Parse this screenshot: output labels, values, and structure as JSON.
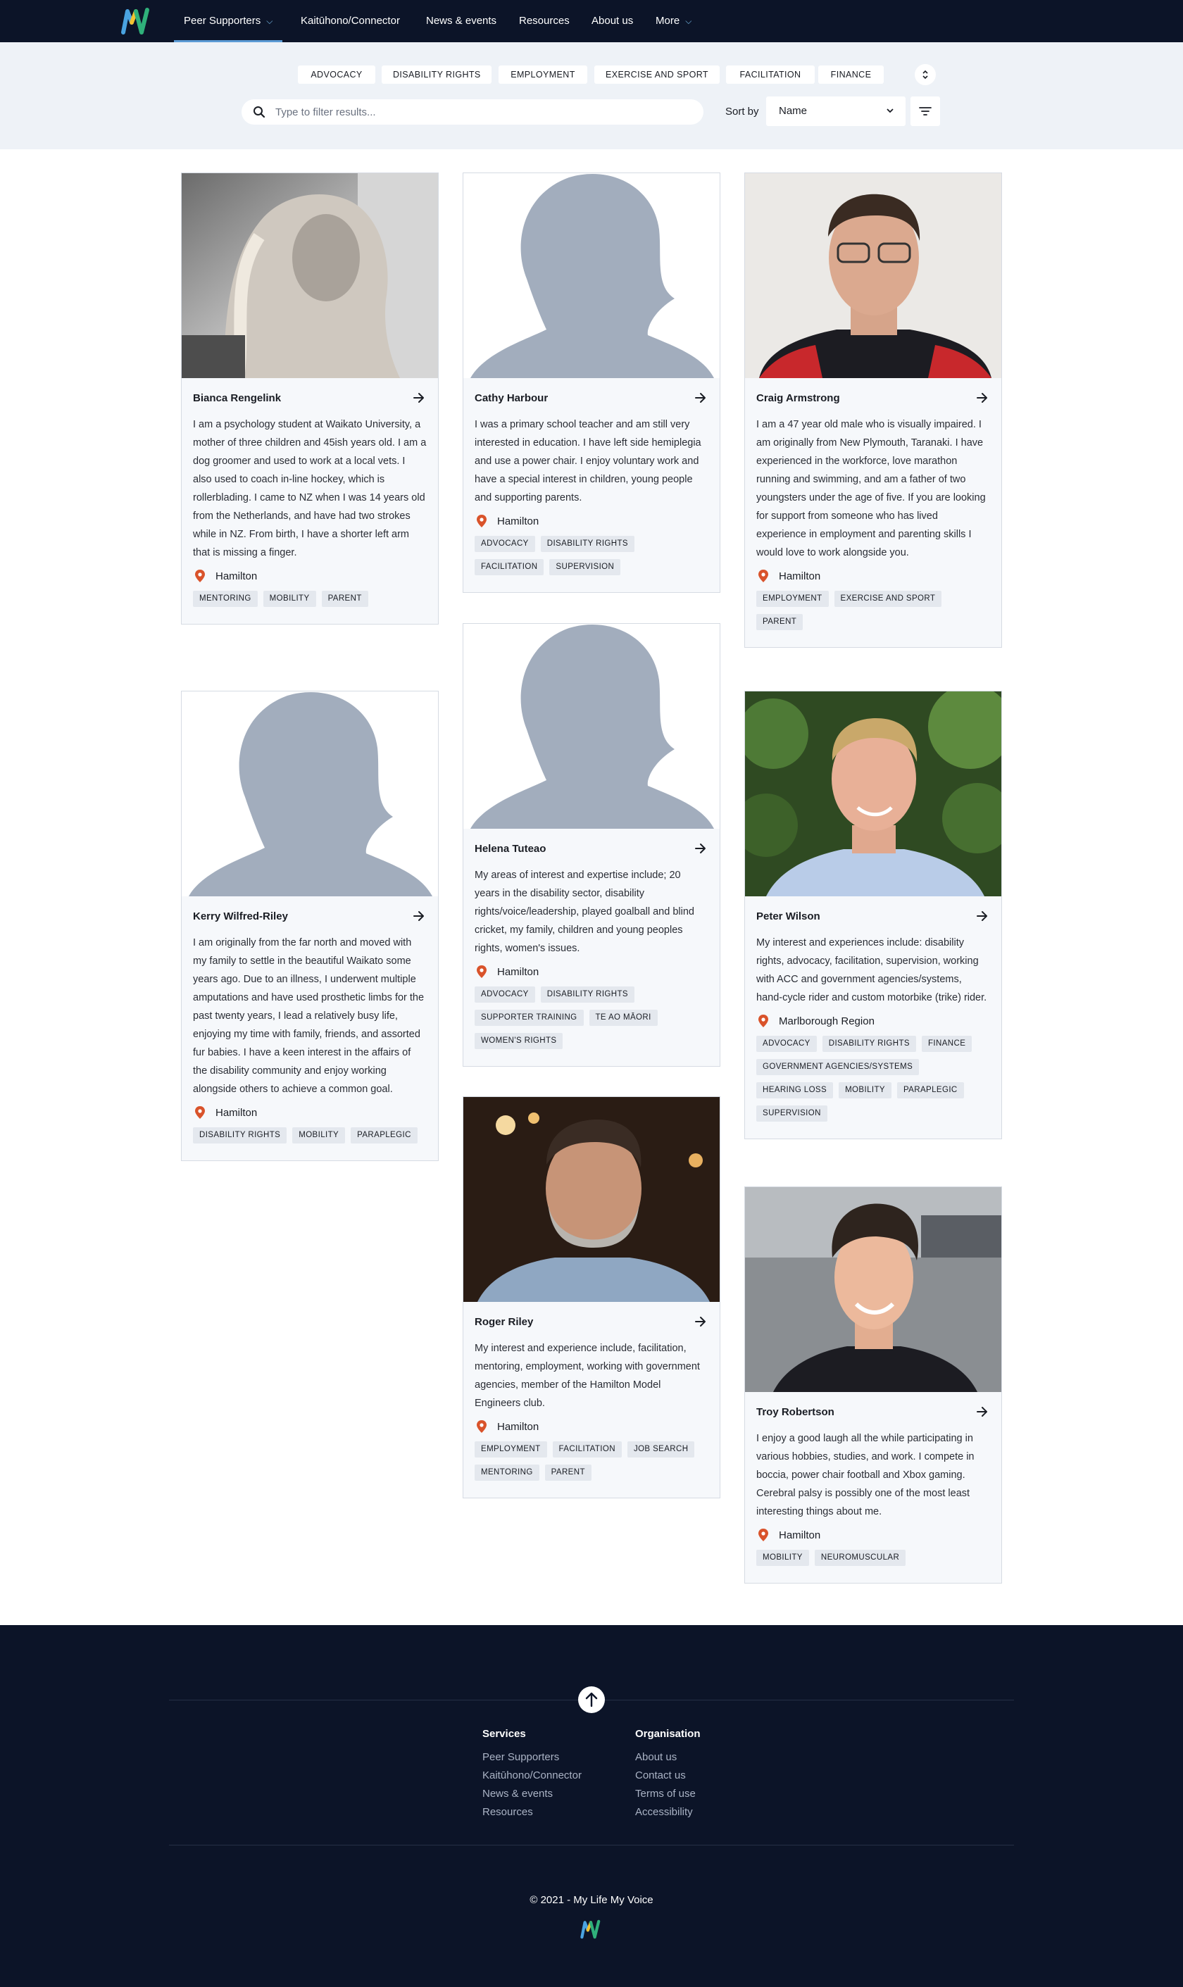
{
  "nav": {
    "items": [
      {
        "label": "Peer Supporters"
      },
      {
        "label": "Kaitūhono/Connector"
      },
      {
        "label": "News & events"
      },
      {
        "label": "Resources"
      },
      {
        "label": "About us"
      },
      {
        "label": "More"
      }
    ]
  },
  "filters": {
    "tags": [
      "ADVOCACY",
      "DISABILITY RIGHTS",
      "EMPLOYMENT",
      "EXERCISE AND SPORT",
      "FACILITATION",
      "FINANCE"
    ],
    "search_placeholder": "Type to filter results...",
    "sort_label": "Sort by",
    "sort_value": "Name"
  },
  "cards": [
    {
      "name": "Bianca Rengelink",
      "bio": "I am a psychology student at Waikato University, a mother of three children and 45ish years old. I am a dog groomer and used to work at a local vets. I also used to coach in-line hockey, which is rollerblading. I came to NZ when I was 14 years old from the Netherlands, and have had two strokes while in NZ. From birth, I have a shorter left arm that is missing a finger.",
      "location": "Hamilton",
      "tags": [
        "MENTORING",
        "MOBILITY",
        "PARENT"
      ]
    },
    {
      "name": "Cathy Harbour",
      "bio": "I was a primary school teacher and am still very interested in education. I have left side hemiplegia and use a power chair. I enjoy voluntary work and have a special interest in children, young people and supporting parents.",
      "location": "Hamilton",
      "tags": [
        "ADVOCACY",
        "DISABILITY RIGHTS",
        "FACILITATION",
        "SUPERVISION"
      ]
    },
    {
      "name": "Craig Armstrong",
      "bio": "I am a 47 year old male who is visually impaired. I am originally from New Plymouth, Taranaki. I have experienced in the workforce, love marathon running and swimming, and am a father of two youngsters under the age of five. If you are looking for support from someone who has lived experience in employment and parenting skills I would love to work alongside you.",
      "location": "Hamilton",
      "tags": [
        "EMPLOYMENT",
        "EXERCISE AND SPORT",
        "PARENT"
      ]
    },
    {
      "name": "Kerry Wilfred-Riley",
      "bio": "I am originally from the far north and moved with my family to settle in the beautiful Waikato some years ago. Due to an illness, I underwent multiple amputations and have used prosthetic limbs for the past twenty years, I lead a relatively busy life, enjoying my time with family, friends, and assorted fur babies. I have a keen interest in the affairs of the disability community and enjoy working alongside others to achieve a common goal.",
      "location": "Hamilton",
      "tags": [
        "DISABILITY RIGHTS",
        "MOBILITY",
        "PARAPLEGIC"
      ]
    },
    {
      "name": "Helena Tuteao",
      "bio": "My areas of interest and expertise include; 20 years in the disability sector, disability rights/voice/leadership, played goalball and blind cricket, my family, children and young peoples rights, women's issues.",
      "location": "Hamilton",
      "tags": [
        "ADVOCACY",
        "DISABILITY RIGHTS",
        "SUPPORTER TRAINING",
        "TE AO MĀORI",
        "WOMEN'S RIGHTS"
      ]
    },
    {
      "name": "Peter Wilson",
      "bio": "My interest and experiences include: disability rights, advocacy, facilitation, supervision, working with ACC and government agencies/systems, hand-cycle rider and custom motorbike (trike) rider.",
      "location": "Marlborough Region",
      "tags": [
        "ADVOCACY",
        "DISABILITY RIGHTS",
        "FINANCE",
        "GOVERNMENT AGENCIES/SYSTEMS",
        "HEARING LOSS",
        "MOBILITY",
        "PARAPLEGIC",
        "SUPERVISION"
      ]
    },
    {
      "name": "Roger Riley",
      "bio": "My interest and experience include, facilitation, mentoring, employment, working with government agencies, member of the Hamilton Model Engineers club.",
      "location": "Hamilton",
      "tags": [
        "EMPLOYMENT",
        "FACILITATION",
        "JOB SEARCH",
        "MENTORING",
        "PARENT"
      ]
    },
    {
      "name": "Troy Robertson",
      "bio": "I enjoy a good laugh all the while participating in various hobbies, studies, and work. I compete in boccia, power chair football and Xbox gaming. Cerebral palsy is possibly one of the most least interesting things about me.",
      "location": "Hamilton",
      "tags": [
        "MOBILITY",
        "NEUROMUSCULAR"
      ]
    }
  ],
  "footer": {
    "services_title": "Services",
    "services": [
      "Peer Supporters",
      "Kaitūhono/Connector",
      "News & events",
      "Resources"
    ],
    "organisation_title": "Organisation",
    "organisation": [
      "About us",
      "Contact us",
      "Terms of use",
      "Accessibility"
    ],
    "copyright": "© 2021 - My Life My Voice"
  },
  "colors": {
    "nav_bg": "#0c1428",
    "filter_bg": "#eef2f7",
    "card_bg": "#f6f8fb",
    "tag_bg": "#e4e8ee",
    "pin": "#d9532b",
    "silhouette": "#a2adbd",
    "logo_blue": "#4aa3e0",
    "logo_yellow": "#f2c230",
    "logo_green": "#2fb07a"
  },
  "icons": [
    "logo-icon",
    "chevron-down-icon",
    "search-icon",
    "sort-caret-icon",
    "filter-icon",
    "expand-icon",
    "arrow-right-icon",
    "location-pin-icon",
    "arrow-up-icon"
  ]
}
